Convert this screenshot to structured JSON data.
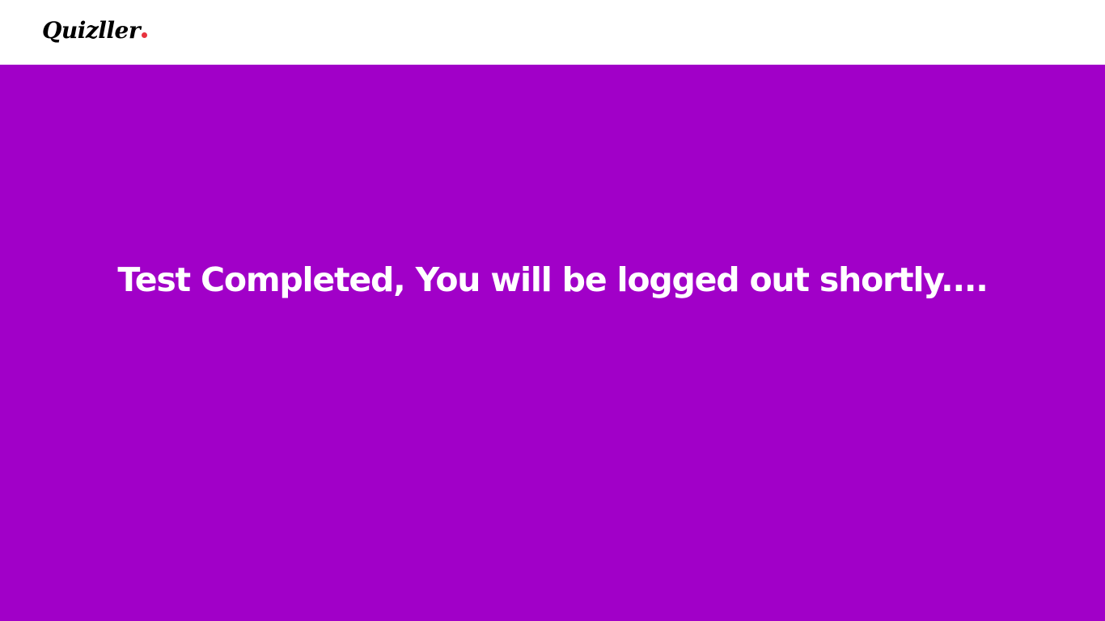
{
  "header": {
    "logo_text": "Quizller",
    "logo_dot_color": "#e8333f",
    "background": "#ffffff"
  },
  "main": {
    "background": "#a100c8",
    "message": "Test Completed, You will be logged out shortly...."
  }
}
